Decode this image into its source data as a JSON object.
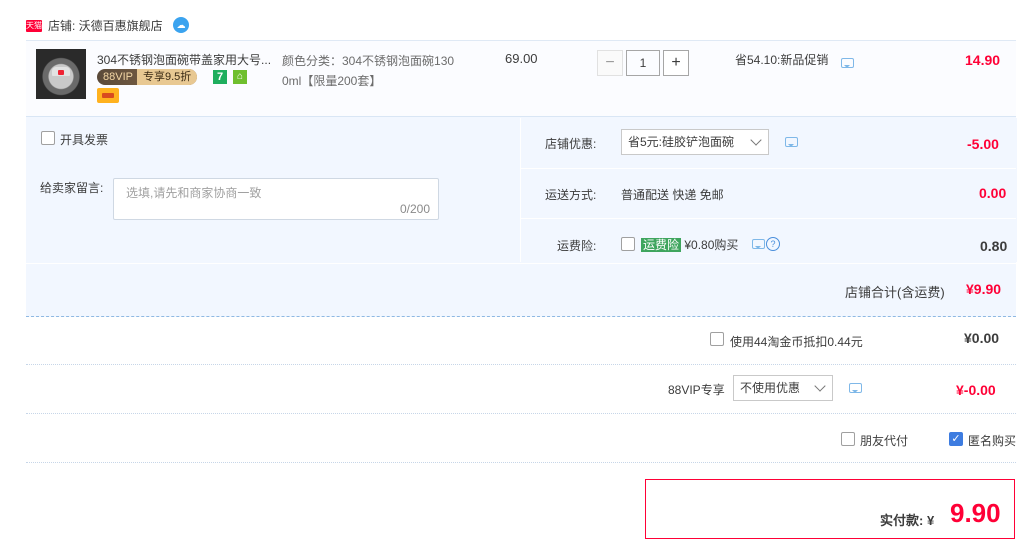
{
  "shop": {
    "tag": "天猫",
    "name": "店铺: 沃德百惠旗舰店",
    "contact_icon": "wangwang-icon"
  },
  "item": {
    "title": "304不锈钢泡面碗带盖家用大号...",
    "vip_label": "88VIP",
    "vip_discount": "专享9.5折",
    "badge_7": "7",
    "sku_line1": "颜色分类：304不锈钢泡面碗130",
    "sku_line2": "0ml【限量200套】",
    "unit_price": "69.00",
    "qty_minus": "−",
    "qty_value": "1",
    "qty_plus": "+",
    "promo": "省54.10:新品促销",
    "subtotal": "14.90"
  },
  "options": {
    "invoice_label": "开具发票",
    "memo_label": "给卖家留言:",
    "memo_placeholder": "选填,请先和商家协商一致",
    "memo_count": "0/200",
    "shop_discount_label": "店铺优惠:",
    "shop_discount_value": "省5元:硅胶铲泡面碗",
    "shop_discount_amount": "-5.00",
    "shipping_label": "运送方式:",
    "shipping_value": "普通配送 快递 免邮",
    "shipping_amount": "0.00",
    "insurance_label": "运费险:",
    "insurance_tag": "运费险",
    "insurance_text": "¥0.80购买",
    "insurance_amount": "0.80",
    "shop_total_label": "店铺合计(含运费)",
    "shop_total_value": "¥9.90"
  },
  "summary": {
    "coins_label": "使用44淘金币抵扣0.44元",
    "coins_amount": "¥0.00",
    "vip_label": "88VIP专享",
    "vip_select": "不使用优惠",
    "vip_amount": "¥-0.00",
    "friend_pay": "朋友代付",
    "anonymous": "匿名购买",
    "pay_label": "实付款: ¥",
    "pay_amount": "9.90"
  },
  "colors": {
    "accent_red": "#ff0036",
    "panel_blue": "#f2f7ff"
  }
}
